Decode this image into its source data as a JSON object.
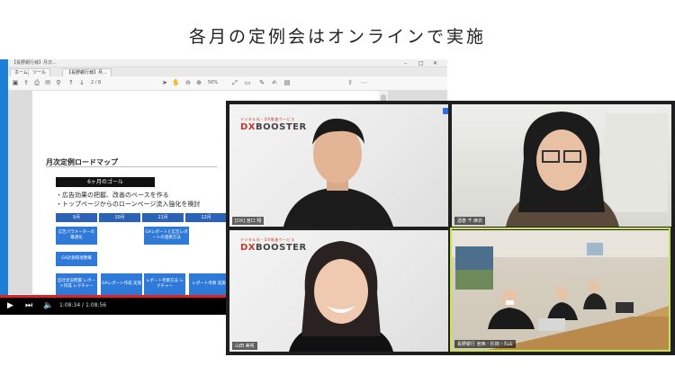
{
  "headline": "各月の定例会はオンラインで実施",
  "share": {
    "titlebar": "【長野銀行様】月次...",
    "tabs": [
      "ホーム",
      "ツール",
      "【長野銀行様】月..."
    ],
    "toolbar": {
      "page_indicator": "2 / 8",
      "zoom": "50%"
    },
    "slide": {
      "title": "月次定例ロードマップ",
      "goal": "6ヶ月のゴール",
      "bullets": [
        "広告効果の把握、改善のベースを作る",
        "トップページからのローンページ流入強化を検討"
      ],
      "months": [
        "9月",
        "10月",
        "11月",
        "12月"
      ],
      "boxes": {
        "b1": "広告パラメーターの最適化",
        "b2": "GA計測環境整備",
        "b3": "自社状況把握 レポート作成 レクチャー",
        "b4": "GAレポート作成 実施",
        "b5": "GAレポートと広告レポートの連携方法",
        "b6": "レポート考察方法 レクチャー",
        "b7": "レポート考察 実施"
      }
    },
    "player": {
      "time": "1:08:34 / 1:08:56",
      "progress": 0.995
    }
  },
  "meeting": {
    "logo": {
      "dx": "DX",
      "booster": "BOOSTER",
      "tagline": "デジタル化・DX推進サービス"
    },
    "participants": [
      {
        "name": "[DX] 宮口 翔"
      },
      {
        "name": "酒巻 千 麻衣"
      },
      {
        "name": "山田 美咲"
      },
      {
        "name": "長野銀行 宮西・杉田・丸山"
      }
    ]
  },
  "colors": {
    "accent_green": "#c8e64a",
    "brand_red": "#c0392b",
    "slide_blue": "#2f7ad8"
  }
}
